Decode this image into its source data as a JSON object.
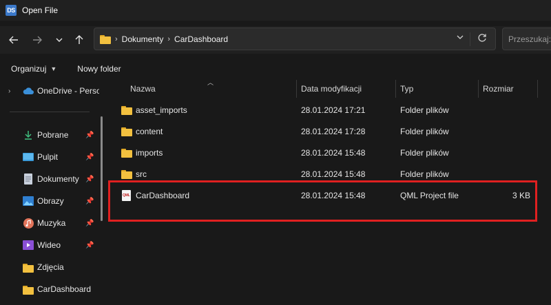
{
  "window": {
    "app_badge": "DS",
    "title": "Open File"
  },
  "address": {
    "breadcrumbs": [
      "Dokumenty",
      "CarDashboard"
    ],
    "search_placeholder": "Przeszukaj: CarDashboard"
  },
  "toolbar": {
    "organize_label": "Organizuj",
    "new_folder_label": "Nowy folder"
  },
  "sidebar": {
    "onedrive_label": "OneDrive - Personal",
    "items": [
      {
        "label": "Pobrane",
        "icon": "download-icon",
        "pinned": true
      },
      {
        "label": "Pulpit",
        "icon": "desktop-icon",
        "pinned": true
      },
      {
        "label": "Dokumenty",
        "icon": "document-icon",
        "pinned": true
      },
      {
        "label": "Obrazy",
        "icon": "pictures-icon",
        "pinned": true
      },
      {
        "label": "Muzyka",
        "icon": "music-icon",
        "pinned": true
      },
      {
        "label": "Wideo",
        "icon": "video-icon",
        "pinned": true
      },
      {
        "label": "Zdjęcia",
        "icon": "folder-icon",
        "pinned": false
      },
      {
        "label": "CarDashboard",
        "icon": "folder-icon",
        "pinned": false
      }
    ]
  },
  "columns": {
    "name": "Nazwa",
    "date": "Data modyfikacji",
    "type": "Typ",
    "size": "Rozmiar"
  },
  "files": [
    {
      "name": "asset_imports",
      "date": "28.01.2024 17:21",
      "type": "Folder plików",
      "size": "",
      "icon": "folder-icon"
    },
    {
      "name": "content",
      "date": "28.01.2024 17:28",
      "type": "Folder plików",
      "size": "",
      "icon": "folder-icon"
    },
    {
      "name": "imports",
      "date": "28.01.2024 15:48",
      "type": "Folder plików",
      "size": "",
      "icon": "folder-icon"
    },
    {
      "name": "src",
      "date": "28.01.2024 15:48",
      "type": "Folder plików",
      "size": "",
      "icon": "folder-icon"
    },
    {
      "name": "CarDashboard",
      "date": "28.01.2024 15:48",
      "type": "QML Project file",
      "size": "3 KB",
      "icon": "qml-project-file-icon",
      "qml_badge": "QML"
    }
  ],
  "colors": {
    "highlight": "#e02020",
    "folder": "#f2c03f",
    "background": "#191919",
    "onedrive": "#3a8fd8"
  }
}
